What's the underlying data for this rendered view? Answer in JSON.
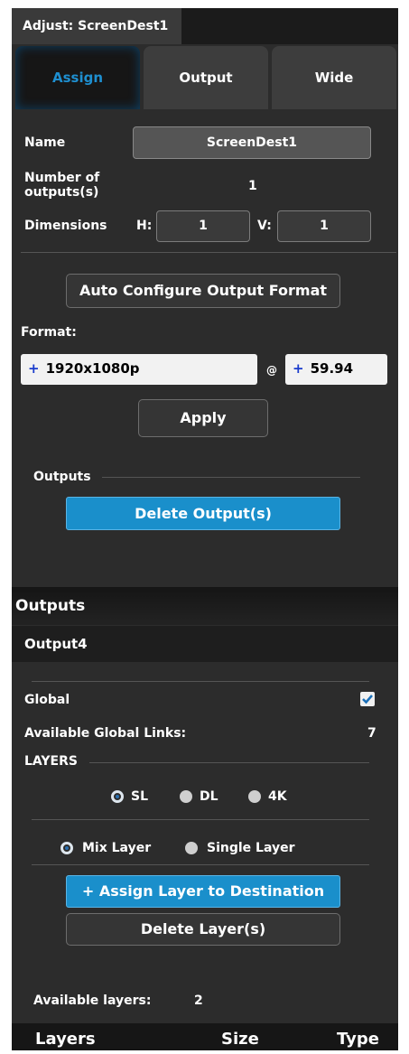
{
  "panel": {
    "title": "Adjust: ScreenDest1",
    "tabs": [
      "Assign",
      "Output",
      "Wide"
    ],
    "active_tab": "Assign"
  },
  "assign": {
    "name_label": "Name",
    "name_value": "ScreenDest1",
    "num_outputs_label_line1": "Number of",
    "num_outputs_label_line2": "outputs(s)",
    "num_outputs_value": "1",
    "dimensions_label": "Dimensions",
    "h_label": "H:",
    "h_value": "1",
    "v_label": "V:",
    "v_value": "1",
    "auto_config_label": "Auto Configure Output Format",
    "format_label": "Format:",
    "resolution_plus": "+",
    "resolution_value": "1920x1080p",
    "at_symbol": "@",
    "rate_plus": "+",
    "rate_value": "59.94",
    "apply_label": "Apply",
    "outputs_sublabel": "Outputs",
    "delete_outputs_label": "Delete Output(s)"
  },
  "outputs_section": {
    "header": "Outputs",
    "selected_output": "Output4",
    "global_label": "Global",
    "global_checked": true,
    "available_links_label": "Available Global Links:",
    "available_links_value": "7",
    "layers_label": "LAYERS",
    "link_options": [
      "SL",
      "DL",
      "4K"
    ],
    "link_selected": "SL",
    "layer_mode_options": [
      "Mix Layer",
      "Single Layer"
    ],
    "layer_mode_selected": "Mix Layer",
    "assign_layer_label": "+ Assign Layer to Destination",
    "delete_layers_label": "Delete Layer(s)",
    "available_layers_label": "Available layers:",
    "available_layers_value": "2"
  },
  "layers_table": {
    "columns": [
      "Layers",
      "Size",
      "Type"
    ]
  },
  "colors": {
    "panel_bg": "#2c2c2c",
    "accent_blue": "#1a8fcb",
    "active_tab_text": "#1e8fd0"
  }
}
